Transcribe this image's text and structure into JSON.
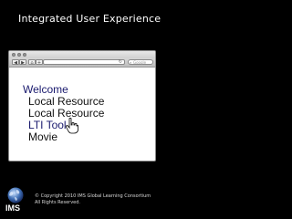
{
  "slide": {
    "title": "Integrated User Experience"
  },
  "browser": {
    "nav": {
      "back": "◀",
      "forward": "▶",
      "home": "⌂",
      "add": "+"
    },
    "search_placeholder": "Google",
    "content": {
      "heading": "Welcome",
      "items": [
        "Local Resource",
        "Local Resource",
        "LTI Tool",
        "Movie"
      ]
    }
  },
  "footer": {
    "copyright": "© Copyright 2010 IMS Global Learning Consortium",
    "rights": "All Rights Reserved.",
    "logo_text": "IMS"
  },
  "colors": {
    "background": "#000000",
    "link": "#1a1a6e",
    "text_light": "#ffffff"
  }
}
